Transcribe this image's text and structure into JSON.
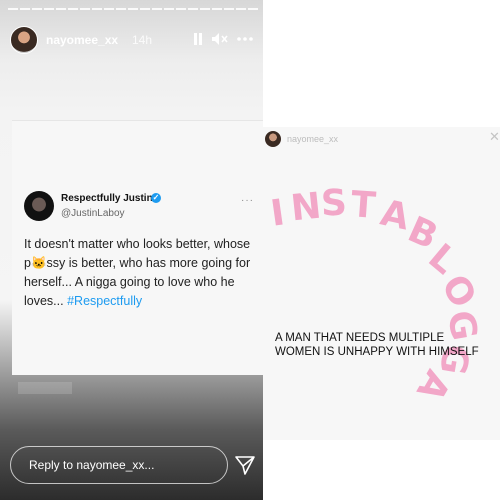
{
  "left_story": {
    "username": "nayomee_xx",
    "time": "14h",
    "tweet": {
      "name": "Respectfully Justin",
      "handle": "@JustinLaboy",
      "more": "···",
      "body_prefix": "It doesn't matter who looks better, whose p",
      "emoji": "🐱",
      "body_suffix": "ssy is better, who has more going for herself... A nigga going to love who he loves...",
      "hashtag": "#Respectfully"
    },
    "reply_placeholder": "Reply to nayomee_xx..."
  },
  "right_story": {
    "username": "nayomee_xx",
    "caption": "A MAN THAT NEEDS MULTIPLE WOMEN IS UNHAPPY WITH HIMSELF",
    "watermark": "INSTABLOGGA"
  },
  "colors": {
    "accent": "#1d9bf0",
    "watermark": "#f2a7c8"
  },
  "icons": [
    "pause-icon",
    "mute-icon",
    "more-icon",
    "verified-icon",
    "send-icon",
    "close-icon"
  ]
}
